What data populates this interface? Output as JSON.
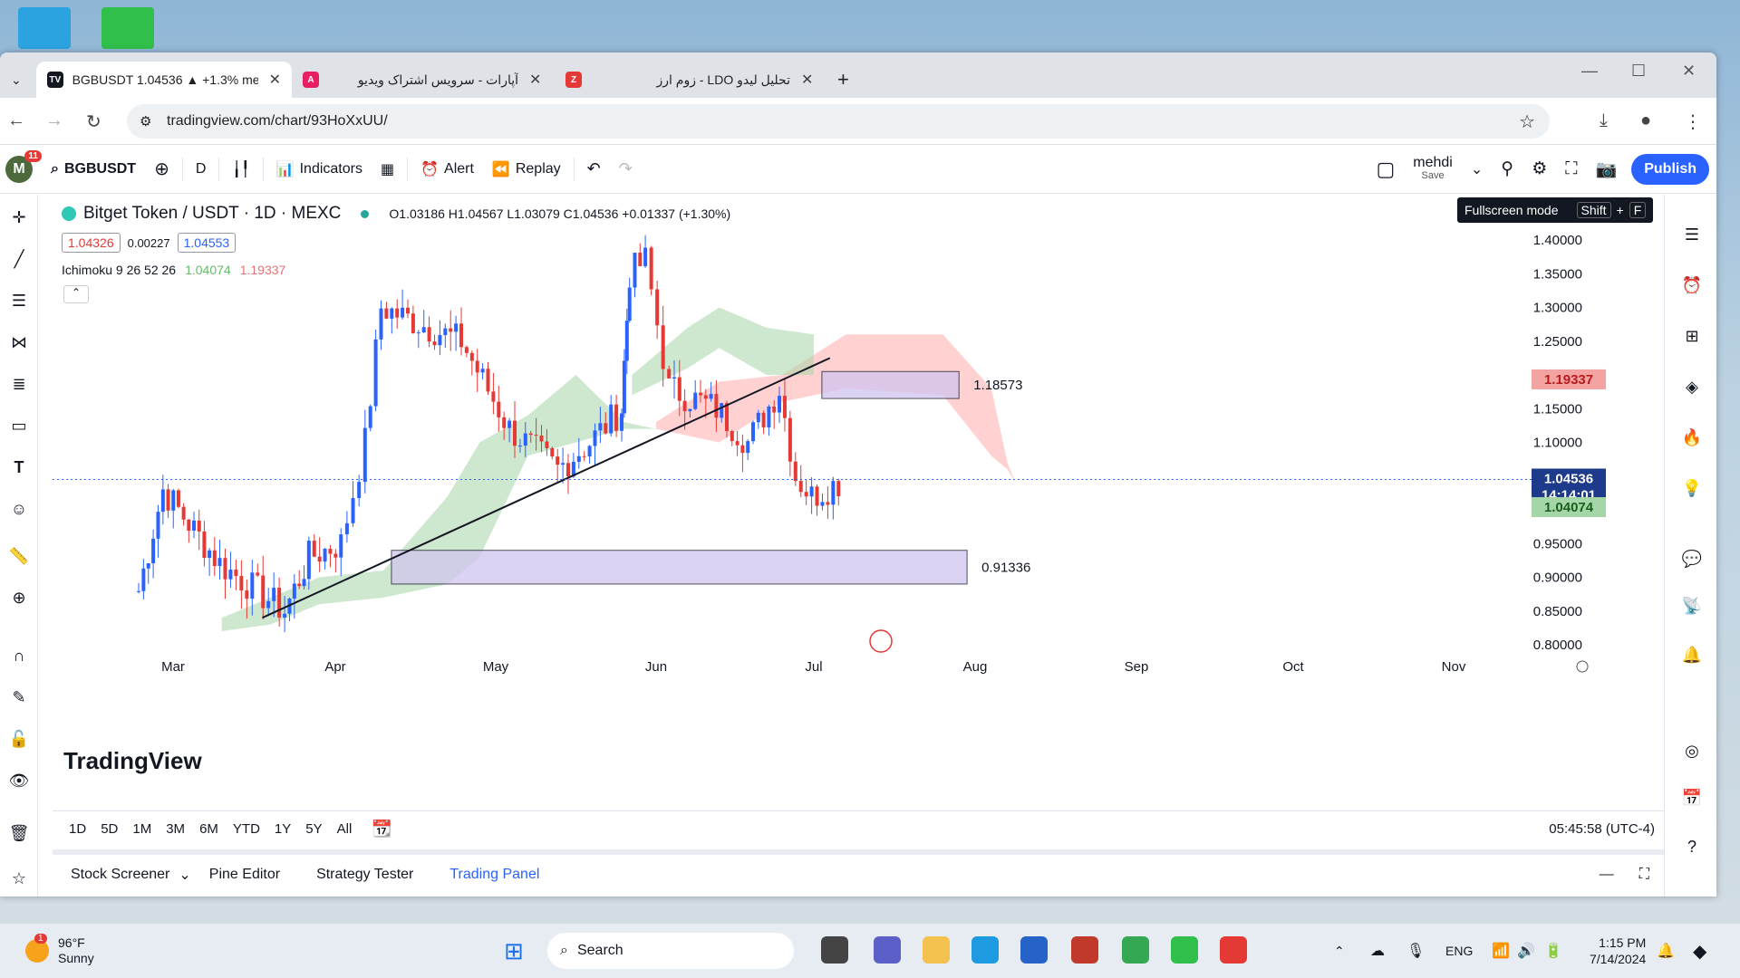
{
  "browser": {
    "tabs": [
      {
        "title": "BGBUSDT 1.04536 ▲ +1.3% me",
        "active": true
      },
      {
        "title": "آپارات - سرویس اشتراک ویدیو",
        "active": false
      },
      {
        "title": "تحلیل لیدو LDO - زوم ارز",
        "active": false
      }
    ],
    "new_tab": "+",
    "url": "tradingview.com/chart/93HoXxUU/"
  },
  "toolbar": {
    "avatar_badge": "11",
    "symbol": "BGBUSDT",
    "interval": "D",
    "indicators": "Indicators",
    "alert": "Alert",
    "replay": "Replay",
    "layout_name": "mehdi",
    "layout_sub": "Save",
    "publish": "Publish",
    "tooltip": "Fullscreen mode",
    "tooltip_key1": "Shift",
    "tooltip_plus": "+",
    "tooltip_key2": "F"
  },
  "legend": {
    "title": "Bitget Token / USDT · 1D · MEXC",
    "ohlc": "O1.03186 H1.04567 L1.03079 C1.04536 +0.01337 (+1.30%)",
    "bid": "1.04326",
    "spread": "0.00227",
    "ask": "1.04553",
    "indicator": "Ichimoku 9 26 52 26",
    "ind_v1": "1.04074",
    "ind_v2": "1.19337"
  },
  "chart_data": {
    "type": "candlestick",
    "symbol": "Bitget Token / USDT",
    "interval": "1D",
    "price_axis": [
      "1.40000",
      "1.35000",
      "1.30000",
      "1.25000",
      "1.20000",
      "1.15000",
      "1.10000",
      "1.05000",
      "1.00000",
      "0.95000",
      "0.90000",
      "0.85000",
      "0.80000"
    ],
    "time_axis": [
      "Mar",
      "Apr",
      "May",
      "Jun",
      "Jul",
      "Aug",
      "Sep",
      "Oct",
      "Nov"
    ],
    "markers": {
      "current_price": "1.04536",
      "countdown": "14:14:01",
      "kijun": "1.04074",
      "senkou": "1.19337"
    },
    "zones": [
      {
        "label": "1.18573",
        "from": 1.165,
        "to": 1.205
      },
      {
        "label": "0.91336",
        "from": 0.89,
        "to": 0.94
      }
    ],
    "watermark": "TradingView"
  },
  "ranges": [
    "1D",
    "5D",
    "1M",
    "3M",
    "6M",
    "YTD",
    "1Y",
    "5Y",
    "All"
  ],
  "clock": "05:45:58 (UTC-4)",
  "panel_tabs": [
    "Stock Screener",
    "Pine Editor",
    "Strategy Tester",
    "Trading Panel"
  ],
  "taskbar": {
    "temp": "96°F",
    "weather": "Sunny",
    "weather_badge": "1",
    "search": "Search",
    "lang": "ENG",
    "time": "1:15 PM",
    "date": "7/14/2024"
  },
  "colors": {
    "up": "#2962ff",
    "down": "#e53935",
    "cloud_up": "#a5d6a7",
    "cloud_down": "#ffb3b3",
    "zone": "#d1c4f0",
    "accent": "#2962ff"
  }
}
